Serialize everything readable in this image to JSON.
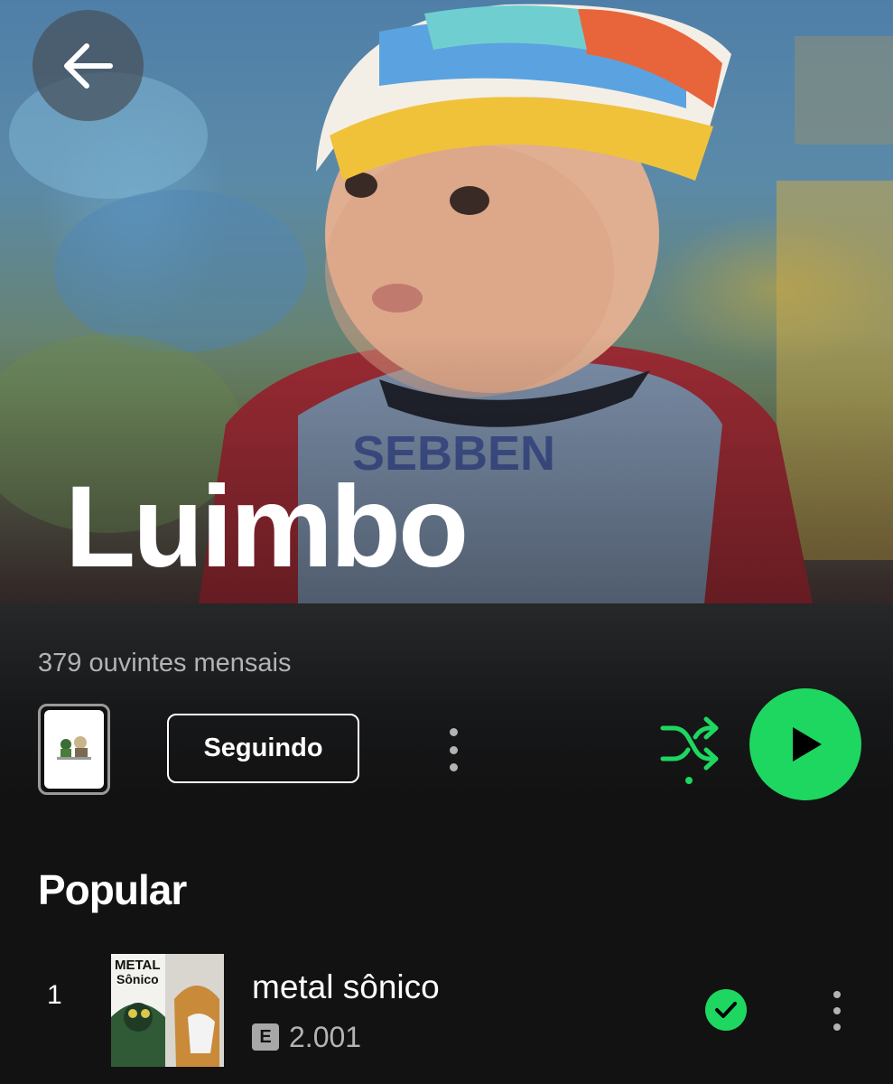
{
  "artist": {
    "name": "Luimbo",
    "monthly_listeners": "379 ouvintes mensais"
  },
  "actions": {
    "follow_label": "Seguindo",
    "shuffle_enabled": true,
    "back_icon": "arrow-left-icon",
    "play_icon": "play-icon",
    "shuffle_icon": "shuffle-icon",
    "more_icon": "more-vertical-icon"
  },
  "popular": {
    "title": "Popular",
    "tracks": [
      {
        "index": "1",
        "title": "metal sônico",
        "explicit_label": "E",
        "plays": "2.001",
        "saved": true,
        "cover_text": "METAL SONICO"
      }
    ]
  },
  "colors": {
    "accent": "#1ed760",
    "background": "#121212",
    "secondary_text": "#b3b3b3"
  }
}
